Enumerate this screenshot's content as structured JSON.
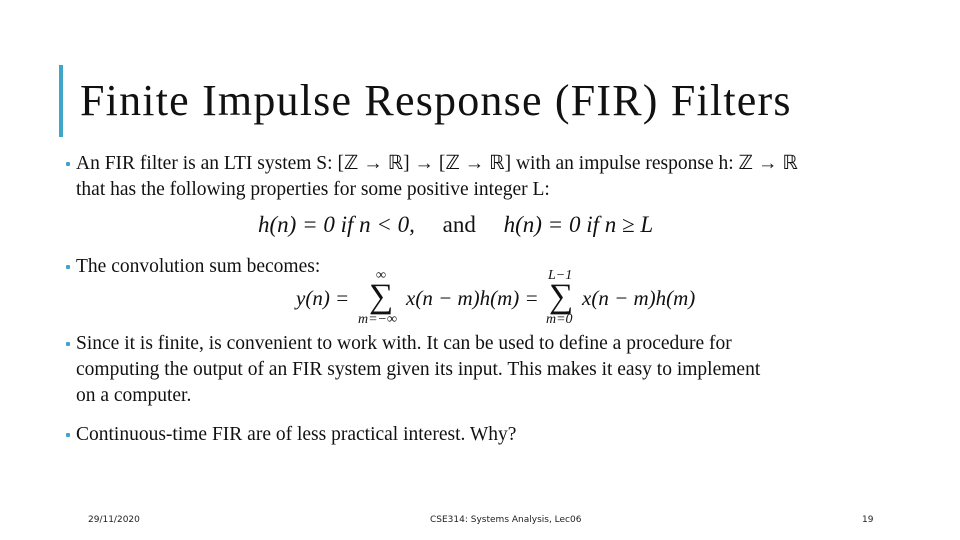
{
  "slide": {
    "title": "Finite Impulse Response (FIR) Filters",
    "accent_color": "#3fa6c9",
    "bullets": [
      {
        "line1": "An FIR filter is an LTI system S: [ℤ → ℝ] → [ℤ → ℝ] with an impulse response h: ℤ → ℝ",
        "line2": "that has the following properties for some positive integer L:"
      },
      {
        "line1": "The convolution sum becomes:"
      },
      {
        "line1": "Since it is finite, is convenient to work with. It can be used to define a procedure for",
        "line2": "computing the output of an FIR system given its input. This makes it easy to implement",
        "line3": "on a computer."
      },
      {
        "line1": "Continuous-time FIR are of less practical interest. Why?"
      }
    ],
    "equations": {
      "eq1": {
        "left": "h(n) = 0 if n < 0,",
        "connector": "and",
        "right": "h(n) = 0 if n ≥ L"
      },
      "eq2": {
        "lhs": "y(n) =",
        "sum1_upper": "∞",
        "sum1_lower": "m=−∞",
        "term1": "x(n − m)h(m) =",
        "sum2_upper": "L−1",
        "sum2_lower": "m=0",
        "term2": "x(n − m)h(m)",
        "sigma": "∑"
      }
    }
  },
  "footer": {
    "date": "29/11/2020",
    "course": "CSE314: Systems Analysis, Lec06",
    "page_number": "19"
  }
}
